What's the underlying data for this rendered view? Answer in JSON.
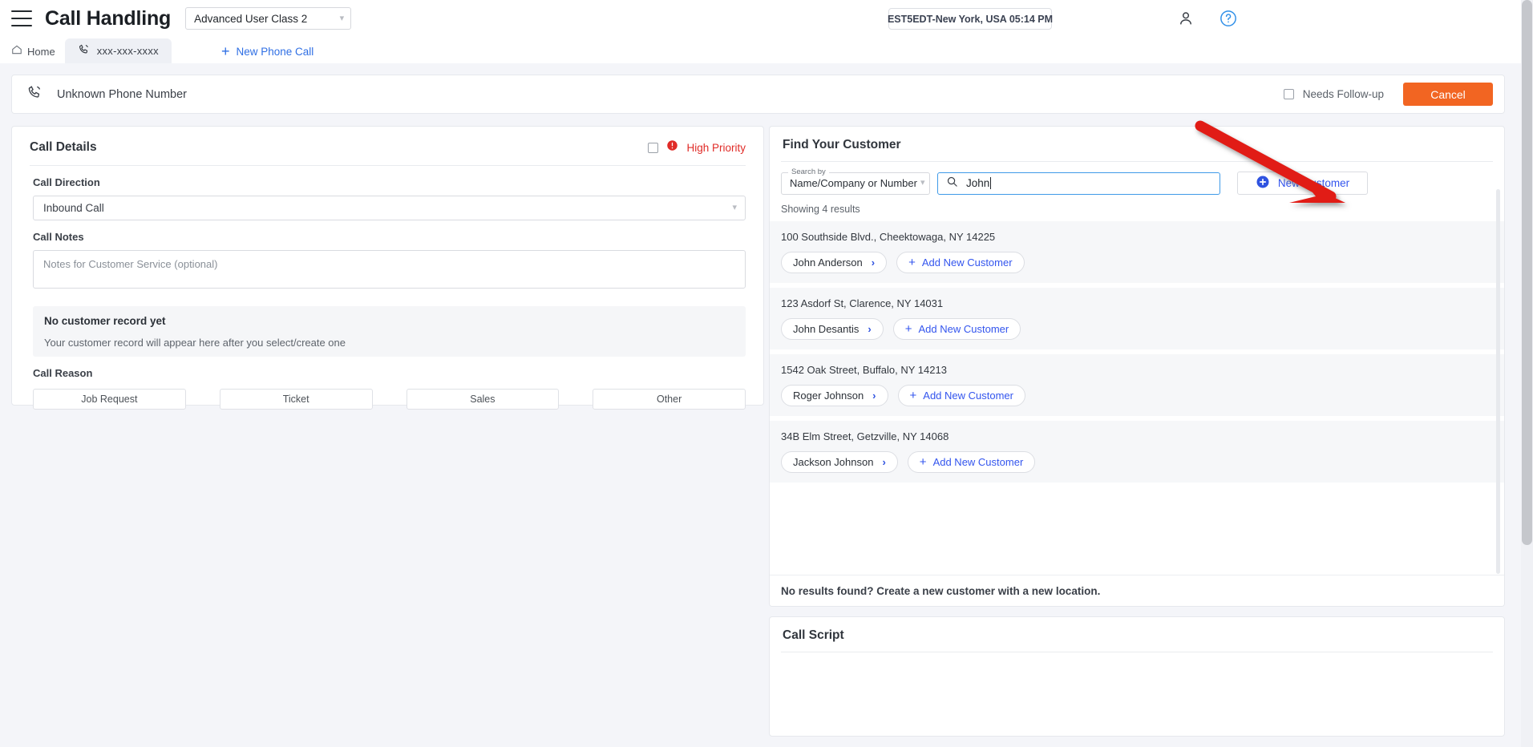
{
  "topbar": {
    "menu_icon": "hamburger-icon",
    "app_title": "Call Handling",
    "user_class": "Advanced User Class 2",
    "timezone_chip": "EST5EDT-New York, USA 05:14 PM",
    "account_icon": "user-icon",
    "help_icon": "help-circle-icon"
  },
  "tabs": {
    "home_label": "Home",
    "home_icon": "home-icon",
    "active_tab_label": "xxx-xxx-xxxx",
    "active_tab_icon": "phone-icon",
    "new_call_label": "New Phone Call",
    "new_call_icon": "plus-icon"
  },
  "call_header": {
    "phone_icon": "phone-icon",
    "phone_number": "Unknown Phone Number",
    "needs_followup_label": "Needs Follow-up",
    "needs_followup_checked": false,
    "cancel_label": "Cancel",
    "cancel_color": "#f26522"
  },
  "call_details": {
    "title": "Call Details",
    "high_priority_label": "High Priority",
    "high_priority_color": "#e02b27",
    "high_priority_icon": "alert-circle-icon",
    "high_priority_checked": false,
    "call_direction_label": "Call Direction",
    "call_direction_value": "Inbound Call",
    "call_notes_label": "Call Notes",
    "call_notes_value": "",
    "call_notes_placeholder": "Notes for Customer Service (optional)",
    "record_title": "No customer record yet",
    "record_subtitle": "Your customer record will appear here after you select/create one",
    "call_reason_label": "Call Reason",
    "call_reasons": [
      "Job Request",
      "Ticket",
      "Sales",
      "Other"
    ]
  },
  "find_customer": {
    "title": "Find Your Customer",
    "search_by_label": "Search by",
    "search_by_value": "Name/Company or Number",
    "search_icon": "search-icon",
    "search_value": "John",
    "search_placeholder": "",
    "new_customer_label": "New Customer",
    "new_customer_icon": "plus-circle-icon",
    "new_customer_color": "#3355ee",
    "showing_results": "Showing 4 results",
    "results": [
      {
        "address": "100 Southside Blvd., Cheektowaga, NY 14225",
        "customer": "John Anderson",
        "add_label": "Add New Customer"
      },
      {
        "address": "123 Asdorf St, Clarence, NY 14031",
        "customer": "John Desantis",
        "add_label": "Add New Customer"
      },
      {
        "address": "1542 Oak Street, Buffalo, NY 14213",
        "customer": "Roger Johnson",
        "add_label": "Add New Customer"
      },
      {
        "address": "34B Elm Street, Getzville, NY 14068",
        "customer": "Jackson Johnson",
        "add_label": "Add New Customer"
      }
    ],
    "no_results_note": "No results found? Create a new customer with a new location."
  },
  "call_script": {
    "title": "Call Script"
  },
  "annotation": {
    "arrow_icon": "red-arrow-annotation",
    "arrow_color": "#e11b14"
  }
}
